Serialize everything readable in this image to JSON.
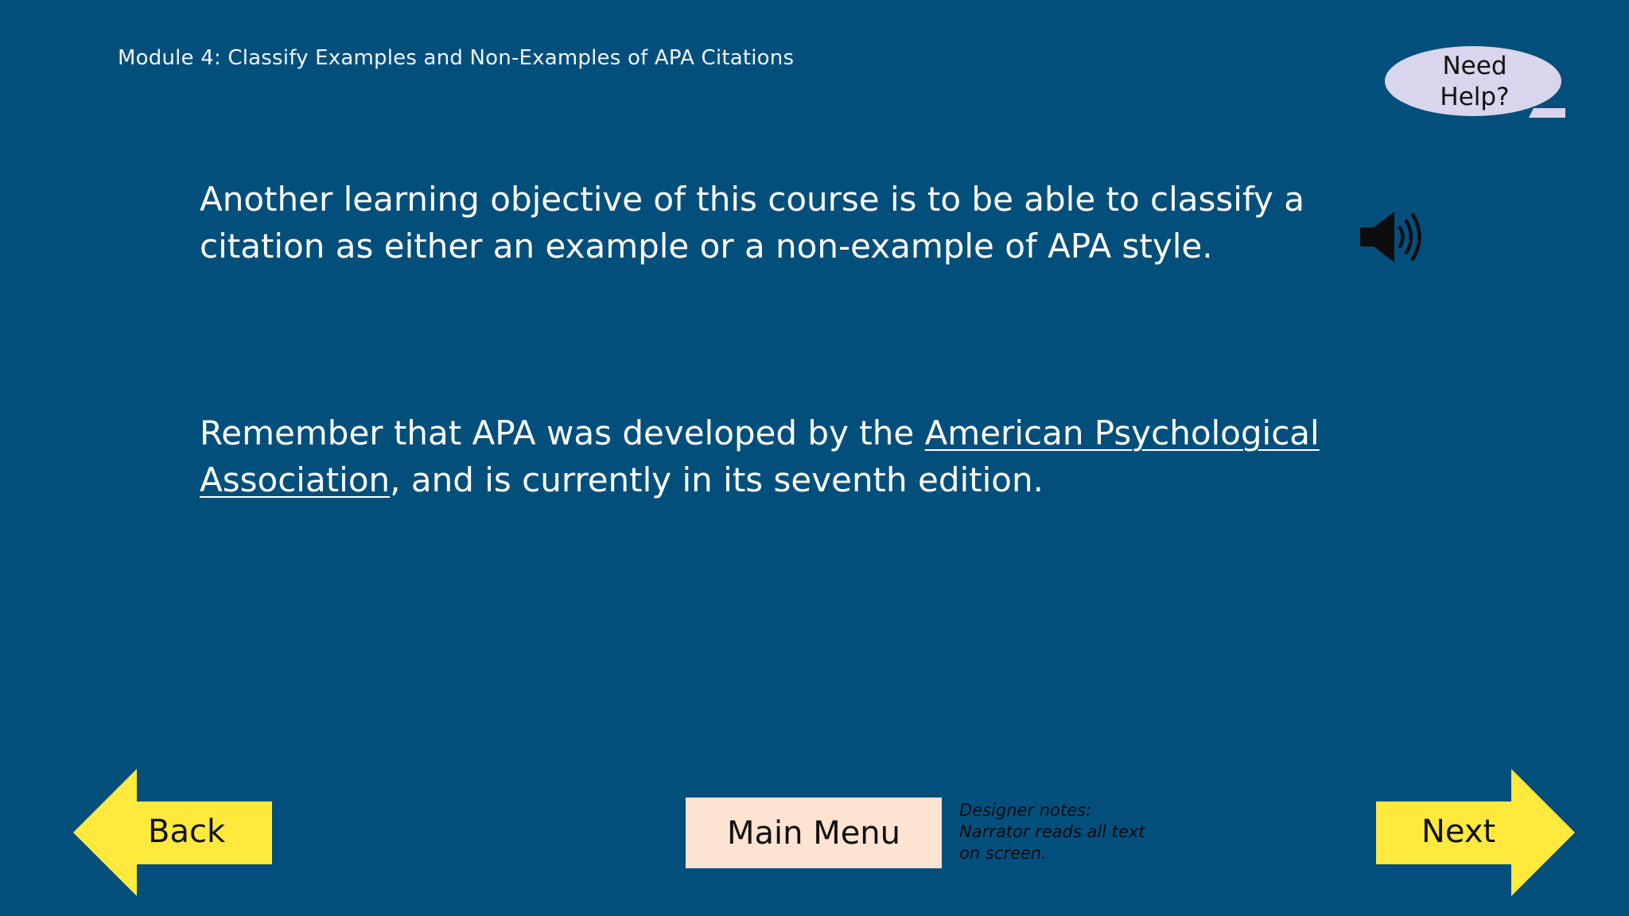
{
  "header": {
    "module_title": "Module 4: Classify Examples and Non-Examples of APA Citations"
  },
  "help": {
    "line1": "Need",
    "line2": "Help?",
    "icon": "speech-bubble-icon"
  },
  "content": {
    "paragraph1": "Another learning objective of this course is to be able to classify a citation as either an example or a non-example of APA style.",
    "paragraph2_before": "Remember that APA was developed by the ",
    "paragraph2_link": "American Psychological Association",
    "paragraph2_after": ", and is currently in its seventh edition."
  },
  "audio": {
    "icon": "speaker-icon"
  },
  "nav": {
    "back_label": "Back",
    "next_label": "Next",
    "main_menu_label": "Main Menu"
  },
  "notes": {
    "line1": "Designer notes:",
    "line2": "Narrator reads all text",
    "line3": "on screen."
  },
  "colors": {
    "background": "#024f7c",
    "arrow_yellow": "#ffe93d",
    "main_menu_bg": "#fde3d1",
    "help_bubble_bg": "#d9d5ec"
  }
}
